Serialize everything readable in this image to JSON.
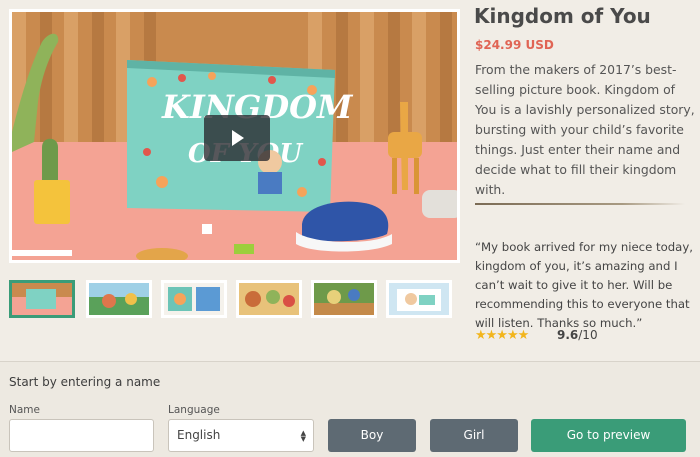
{
  "product": {
    "title": "Kingdom of You",
    "price": "$24.99 USD",
    "description": "From the makers of 2017’s best-selling picture book. Kingdom of You is a lavishly personalized story, bursting with your child’s favorite things. Just enter their name and decide what to fill their kingdom with."
  },
  "hero": {
    "book_title_line1": "KINGDOM",
    "book_title_line2": "OF YOU"
  },
  "review": {
    "quote": "“My book arrived for my niece today, kingdom of you, it’s amazing and I can’t wait to give it to her. Will be recommending this to everyone that will listen. Thanks so much.”",
    "stars": "★★★★★",
    "score": "9.6",
    "score_suffix": "/10"
  },
  "form": {
    "prompt": "Start by entering a name",
    "name_label": "Name",
    "name_value": "",
    "language_label": "Language",
    "language_value": "English",
    "boy_label": "Boy",
    "girl_label": "Girl",
    "preview_label": "Go to preview"
  },
  "colors": {
    "accent_green": "#3a9c78",
    "price_red": "#e06454",
    "button_gray": "#5e6a73",
    "star_yellow": "#f2b51c"
  }
}
